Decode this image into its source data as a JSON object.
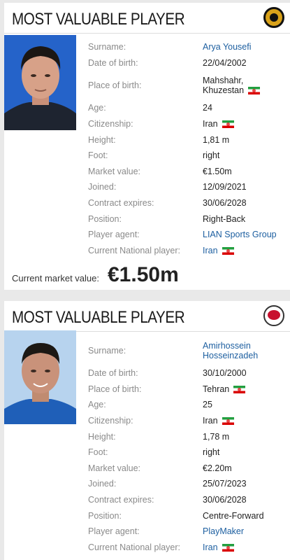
{
  "cards": [
    {
      "title": "MOST VALUABLE PLAYER",
      "club_logo": "sepahan-logo-icon",
      "rows": [
        {
          "label": "Surname:",
          "value": "Arya Yousefi",
          "link": true
        },
        {
          "label": "Date of birth:",
          "value": "22/04/2002"
        },
        {
          "label": "Place of birth:",
          "value": "Mahshahr, Khuzestan",
          "flag": true
        },
        {
          "label": "Age:",
          "value": "24"
        },
        {
          "label": "Citizenship:",
          "value": "Iran",
          "flag": true
        },
        {
          "label": "Height:",
          "value": "1,81 m"
        },
        {
          "label": "Foot:",
          "value": "right"
        },
        {
          "label": "Market value:",
          "value": "€1.50m"
        },
        {
          "label": "Joined:",
          "value": "12/09/2021"
        },
        {
          "label": "Contract expires:",
          "value": "30/06/2028"
        },
        {
          "label": "Position:",
          "value": "Right-Back"
        },
        {
          "label": "Player agent:",
          "value": "LIAN Sports Group",
          "link": true
        },
        {
          "label": "Current National player:",
          "value": "Iran",
          "link": true,
          "flag": true
        }
      ],
      "current_market_value_label": "Current market value:",
      "current_market_value": "€1.50m"
    },
    {
      "title": "MOST VALUABLE PLAYER",
      "club_logo": "persepolis-logo-icon",
      "rows": [
        {
          "label": "Surname:",
          "value": "Amirhossein Hosseinzadeh",
          "link": true
        },
        {
          "label": "Date of birth:",
          "value": "30/10/2000"
        },
        {
          "label": "Place of birth:",
          "value": "Tehran",
          "flag": true
        },
        {
          "label": "Age:",
          "value": "25"
        },
        {
          "label": "Citizenship:",
          "value": "Iran",
          "flag": true
        },
        {
          "label": "Height:",
          "value": "1,78 m"
        },
        {
          "label": "Foot:",
          "value": "right"
        },
        {
          "label": "Market value:",
          "value": "€2.20m"
        },
        {
          "label": "Joined:",
          "value": "25/07/2023"
        },
        {
          "label": "Contract expires:",
          "value": "30/06/2028"
        },
        {
          "label": "Position:",
          "value": "Centre-Forward"
        },
        {
          "label": "Player agent:",
          "value": "PlayMaker",
          "link": true
        },
        {
          "label": "Current National player:",
          "value": "Iran",
          "link": true,
          "flag": true
        }
      ]
    }
  ]
}
